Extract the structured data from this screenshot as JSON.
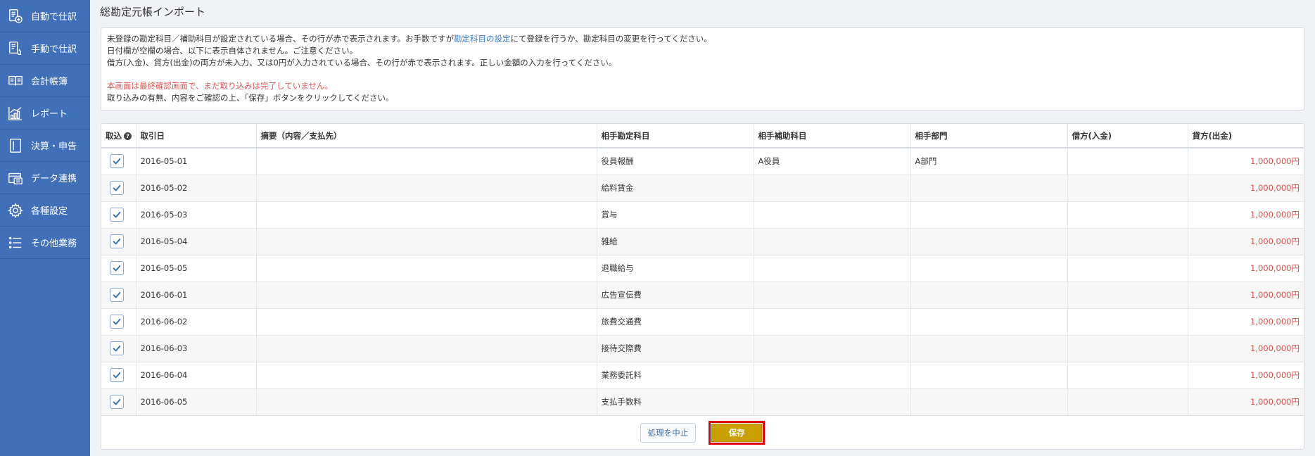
{
  "sidebar": {
    "items": [
      {
        "label": "自動で仕訳",
        "icon": "auto-journal-icon"
      },
      {
        "label": "手動で仕訳",
        "icon": "manual-journal-icon"
      },
      {
        "label": "会計帳簿",
        "icon": "ledger-book-icon"
      },
      {
        "label": "レポート",
        "icon": "report-chart-icon"
      },
      {
        "label": "決算・申告",
        "icon": "settlement-icon"
      },
      {
        "label": "データ連携",
        "icon": "data-link-icon"
      },
      {
        "label": "各種設定",
        "icon": "gear-icon"
      },
      {
        "label": "その他業務",
        "icon": "list-icon"
      }
    ],
    "bg_color": "#4170b8"
  },
  "page": {
    "title": "総勘定元帳インポート"
  },
  "notice": {
    "line1_pre": "未登録の勘定科目／補助科目が設定されている場合、その行が赤で表示されます。お手数ですが",
    "line1_link": "勘定科目の設定",
    "line1_post": "にて登録を行うか、勘定科目の変更を行ってください。",
    "line2": "日付欄が空欄の場合、以下に表示自体されません。ご注意ください。",
    "line3": "借方(入金)、貸方(出金)の両方が未入力、又は0円が入力されている場合、その行が赤で表示されます。正しい金額の入力を行ってください。",
    "warning": "本画面は最終確認画面で、まだ取り込みは完了していません。",
    "line5": "取り込みの有無、内容をご確認の上、「保存」ボタンをクリックしてください。"
  },
  "table": {
    "headers": {
      "import": "取込",
      "help": "?",
      "date": "取引日",
      "desc": "摘要（内容／支払先）",
      "account": "相手勘定科目",
      "sub_account": "相手補助科目",
      "department": "相手部門",
      "debit": "借方(入金)",
      "credit": "貸方(出金)"
    },
    "rows": [
      {
        "date": "2016-05-01",
        "desc": "",
        "account": "役員報酬",
        "sub_account": "A役員",
        "department": "A部門",
        "debit": "",
        "credit": "1,000,000円",
        "checked": true
      },
      {
        "date": "2016-05-02",
        "desc": "",
        "account": "給料賃金",
        "sub_account": "",
        "department": "",
        "debit": "",
        "credit": "1,000,000円",
        "checked": true
      },
      {
        "date": "2016-05-03",
        "desc": "",
        "account": "賞与",
        "sub_account": "",
        "department": "",
        "debit": "",
        "credit": "1,000,000円",
        "checked": true
      },
      {
        "date": "2016-05-04",
        "desc": "",
        "account": "雑給",
        "sub_account": "",
        "department": "",
        "debit": "",
        "credit": "1,000,000円",
        "checked": true
      },
      {
        "date": "2016-05-05",
        "desc": "",
        "account": "退職給与",
        "sub_account": "",
        "department": "",
        "debit": "",
        "credit": "1,000,000円",
        "checked": true
      },
      {
        "date": "2016-06-01",
        "desc": "",
        "account": "広告宣伝費",
        "sub_account": "",
        "department": "",
        "debit": "",
        "credit": "1,000,000円",
        "checked": true
      },
      {
        "date": "2016-06-02",
        "desc": "",
        "account": "旅費交通費",
        "sub_account": "",
        "department": "",
        "debit": "",
        "credit": "1,000,000円",
        "checked": true
      },
      {
        "date": "2016-06-03",
        "desc": "",
        "account": "接待交際費",
        "sub_account": "",
        "department": "",
        "debit": "",
        "credit": "1,000,000円",
        "checked": true
      },
      {
        "date": "2016-06-04",
        "desc": "",
        "account": "業務委託料",
        "sub_account": "",
        "department": "",
        "debit": "",
        "credit": "1,000,000円",
        "checked": true
      },
      {
        "date": "2016-06-05",
        "desc": "",
        "account": "支払手数料",
        "sub_account": "",
        "department": "",
        "debit": "",
        "credit": "1,000,000円",
        "checked": true
      }
    ]
  },
  "footer": {
    "cancel_label": "処理を中止",
    "save_label": "保存"
  },
  "colors": {
    "accent": "#4170b8",
    "amount_red": "#d9534f",
    "save_button": "#c9a000",
    "highlight_border": "#e00000"
  }
}
